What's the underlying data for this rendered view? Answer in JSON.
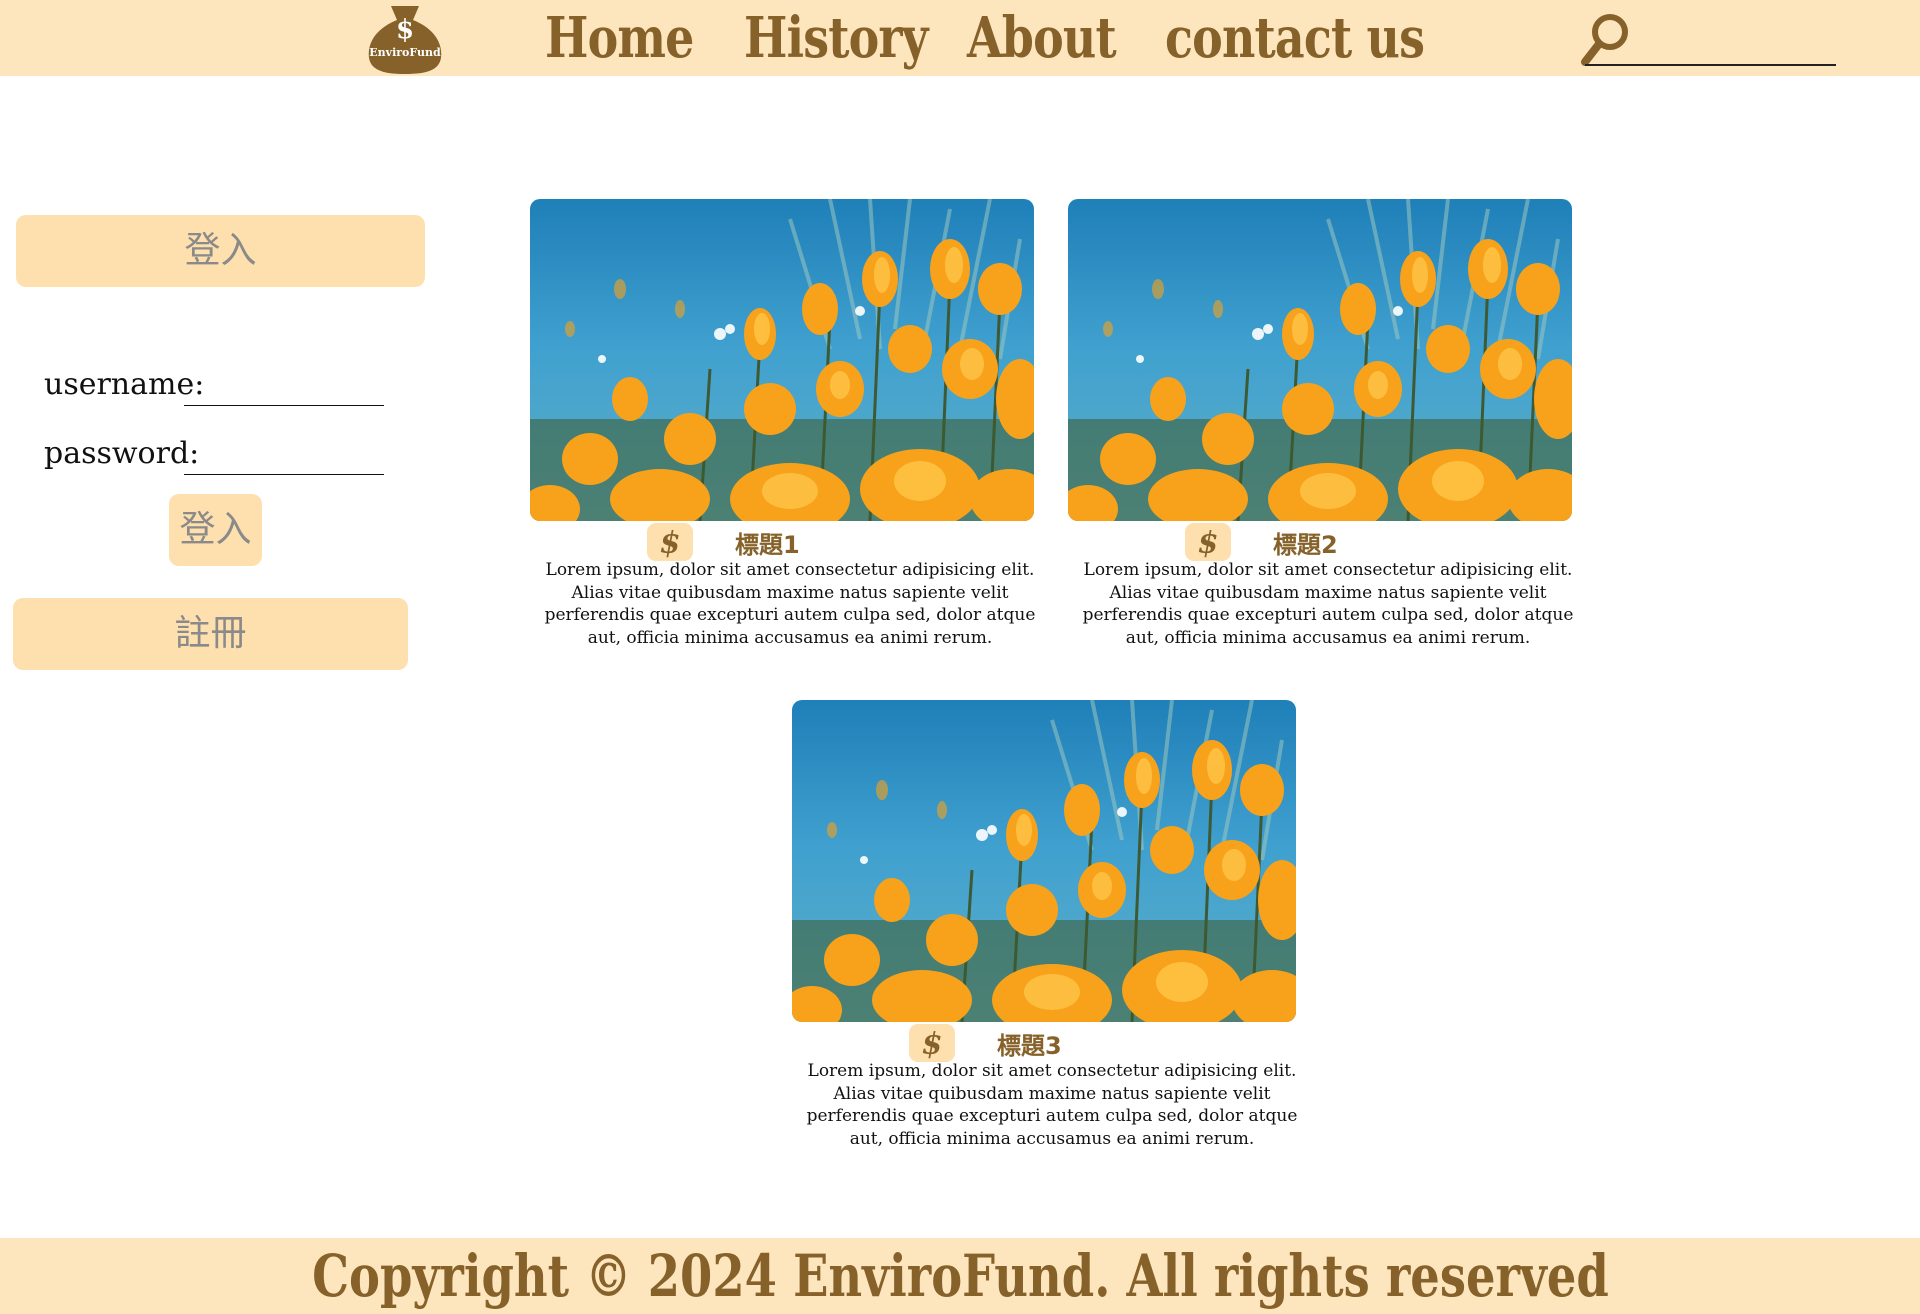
{
  "header": {
    "logo_text": "EnviroFund",
    "nav": [
      "Home",
      "History",
      "About",
      "contact us"
    ],
    "search": {
      "placeholder": ""
    }
  },
  "sidebar": {
    "login_header": "登入",
    "username_label": "username:",
    "password_label": "password:",
    "login_button": "登入",
    "register_button": "註冊"
  },
  "cards": [
    {
      "title": "標題1",
      "text": "Lorem ipsum, dolor sit amet consectetur adipisicing elit. Alias vitae quibusdam maxime natus sapiente velit perferendis quae excepturi autem culpa sed, dolor atque aut, officia minima accusamus ea animi rerum."
    },
    {
      "title": "標題2",
      "text": "Lorem ipsum, dolor sit amet consectetur adipisicing elit. Alias vitae quibusdam maxime natus sapiente velit perferendis quae excepturi autem culpa sed, dolor atque aut, officia minima accusamus ea animi rerum."
    },
    {
      "title": "標題3",
      "text": "Lorem ipsum, dolor sit amet consectetur adipisicing elit. Alias vitae quibusdam maxime natus sapiente velit perferendis quae excepturi autem culpa sed, dolor atque aut, officia minima accusamus ea animi rerum."
    }
  ],
  "footer": {
    "text": "Copyright © 2024 EnviroFund. All rights reserved"
  },
  "colors": {
    "header_bg": "#fde6be",
    "accent": "#86622a",
    "button_bg": "#fedfae"
  },
  "icons": {
    "logo": "money-bag-icon",
    "search": "search-icon",
    "card": "dollar-icon"
  }
}
